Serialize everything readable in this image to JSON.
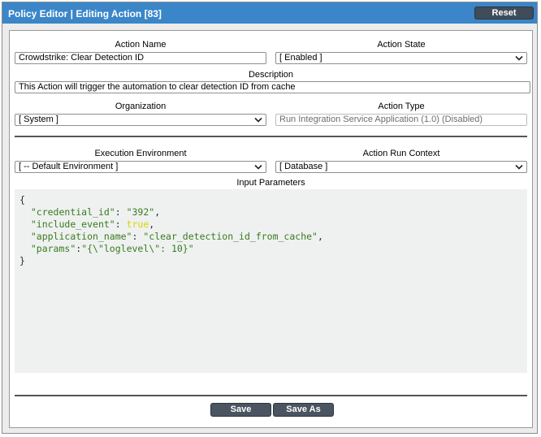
{
  "window": {
    "title": "Policy Editor | Editing Action [83]",
    "reset_label": "Reset"
  },
  "form": {
    "action_name": {
      "label": "Action Name",
      "value": "Crowdstrike: Clear Detection ID"
    },
    "action_state": {
      "label": "Action State",
      "value": "[ Enabled ]"
    },
    "description": {
      "label": "Description",
      "value": "This Action will trigger the automation to clear detection ID from cache"
    },
    "organization": {
      "label": "Organization",
      "value": "[ System ]"
    },
    "action_type": {
      "label": "Action Type",
      "value": "Run Integration Service Application (1.0) (Disabled)"
    },
    "execution_environment": {
      "label": "Execution Environment",
      "value": "[ -- Default Environment ]"
    },
    "action_run_context": {
      "label": "Action Run Context",
      "value": "[ Database ]"
    },
    "input_parameters": {
      "label": "Input Parameters",
      "open_brace": "{",
      "close_brace": "}",
      "lines": [
        {
          "key": "\"credential_id\"",
          "sep": ": ",
          "val": "\"392\"",
          "val_type": "string",
          "tail": ","
        },
        {
          "key": "\"include_event\"",
          "sep": ": ",
          "val": "true",
          "val_type": "bool",
          "tail": ","
        },
        {
          "key": "\"application_name\"",
          "sep": ": ",
          "val": "\"clear_detection_id_from_cache\"",
          "val_type": "string",
          "tail": ","
        },
        {
          "key": "\"params\"",
          "sep": ":",
          "val": "\"{\\\"loglevel\\\": 10}\"",
          "val_type": "string",
          "tail": ""
        }
      ]
    }
  },
  "buttons": {
    "save_label": "Save",
    "save_as_label": "Save As"
  },
  "colors": {
    "titlebar": "#3a86c8",
    "button": "#4b5561",
    "code_bg": "#eef1f0",
    "code_key": "#3a7a1e",
    "code_bool": "#d9d400"
  },
  "icons": {
    "select_arrow": "chevron-down-icon"
  }
}
